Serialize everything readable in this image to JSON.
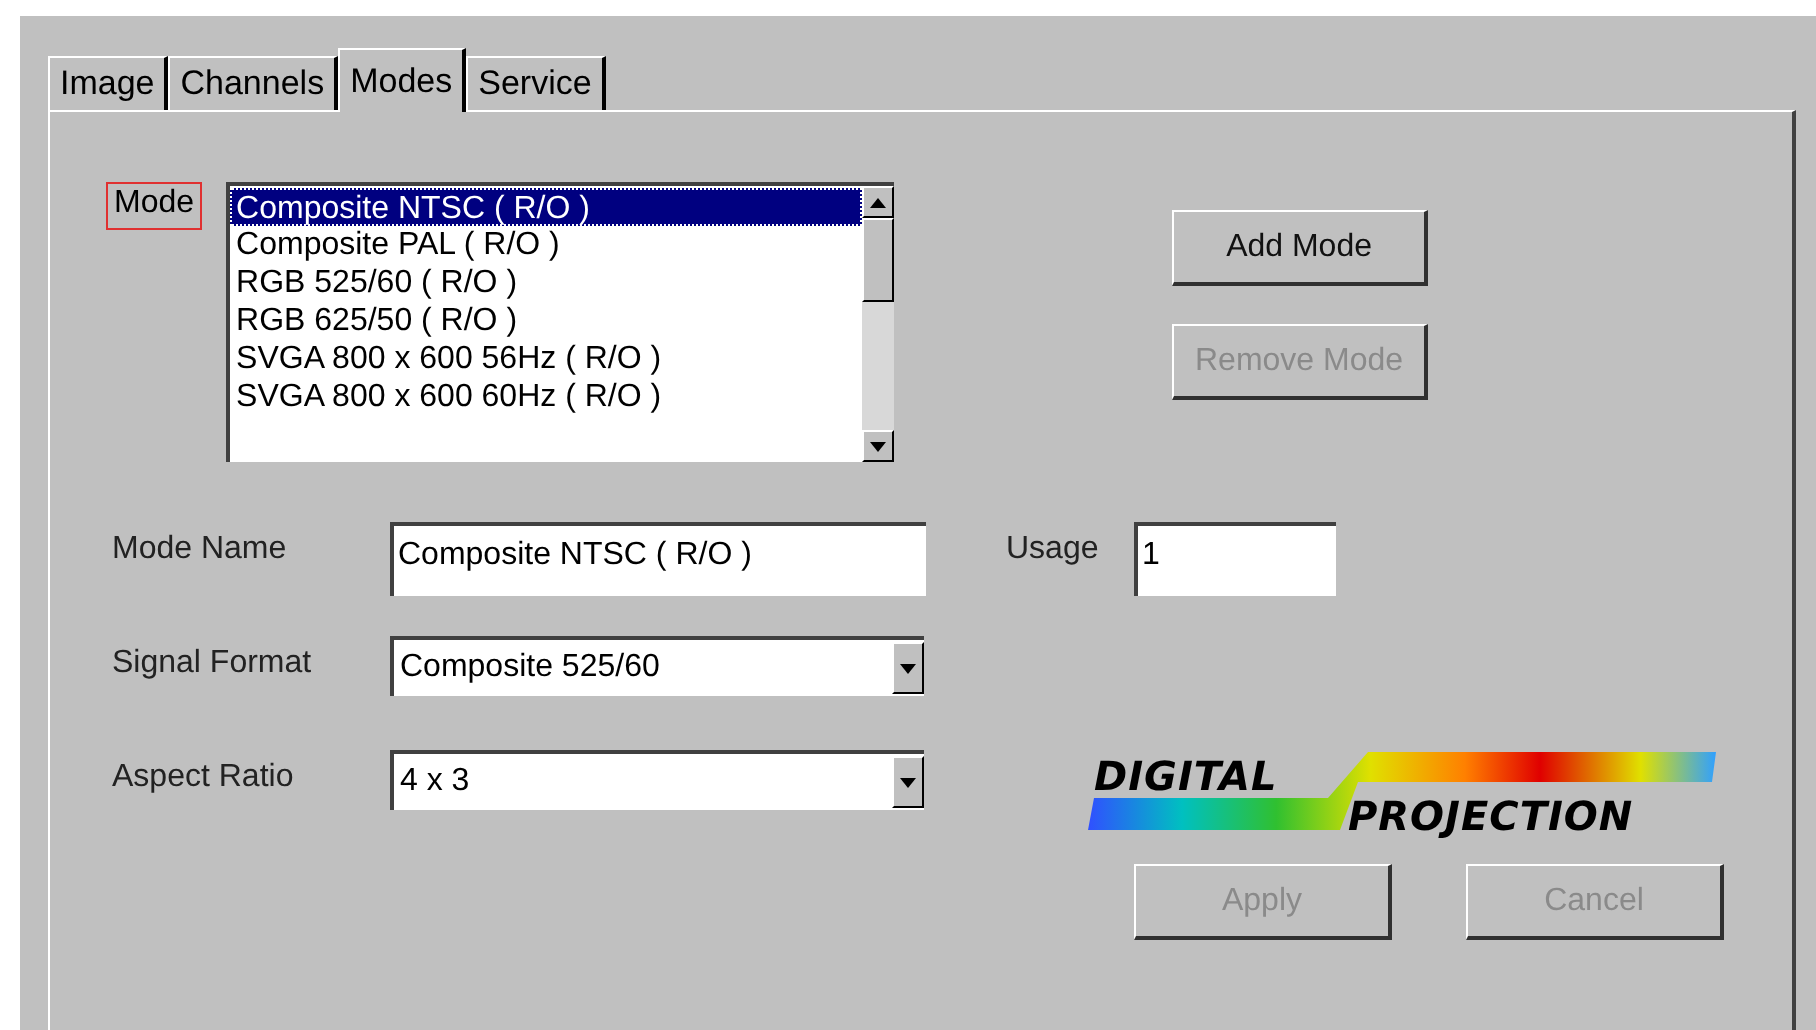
{
  "tabs": [
    {
      "label": "Image",
      "selected": false
    },
    {
      "label": "Channels",
      "selected": false
    },
    {
      "label": "Modes",
      "selected": true
    },
    {
      "label": "Service",
      "selected": false
    }
  ],
  "mode_list": {
    "label": "Mode",
    "items": [
      {
        "label": "Composite NTSC ( R/O )",
        "selected": true
      },
      {
        "label": "Composite PAL ( R/O )",
        "selected": false
      },
      {
        "label": "RGB 525/60 ( R/O )",
        "selected": false
      },
      {
        "label": "RGB 625/50 ( R/O )",
        "selected": false
      },
      {
        "label": "SVGA 800 x 600 56Hz ( R/O )",
        "selected": false
      },
      {
        "label": "SVGA 800 x 600 60Hz ( R/O )",
        "selected": false
      }
    ]
  },
  "mode_buttons": [
    {
      "label": "Add Mode",
      "disabled": false
    },
    {
      "label": "Remove Mode",
      "disabled": true
    }
  ],
  "mode_name": {
    "label": "Mode Name",
    "value": "Composite NTSC ( R/O )"
  },
  "usage": {
    "label": "Usage",
    "value": "1"
  },
  "signal_format": {
    "label": "Signal Format",
    "value": "Composite 525/60"
  },
  "aspect_ratio": {
    "label": "Aspect Ratio",
    "value": "4 x 3"
  },
  "logo": {
    "line_1": "DIGITAL",
    "line_2": "PROJECTION"
  },
  "buttons": [
    {
      "label": "Apply",
      "disabled": true
    },
    {
      "label": "Cancel",
      "disabled": true
    }
  ]
}
